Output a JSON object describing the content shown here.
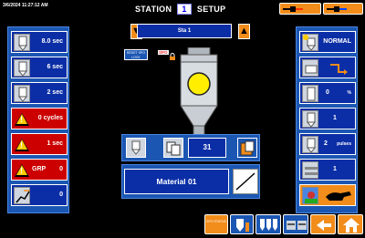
{
  "header": {
    "timestamp": "3/6/2024 11:27:12 AM",
    "title_left": "STATION",
    "station_number": "1",
    "title_right": "SETUP",
    "top_buttons": [
      {
        "label": "",
        "icon": "pump-icon",
        "accent": "#ff3300"
      },
      {
        "label": "",
        "icon": "pump-icon",
        "accent": "#0044ff"
      }
    ]
  },
  "station_selector": {
    "name": "Sta 1",
    "prev_icon": "arrow-down-icon",
    "next_icon": "arrow-up-icon"
  },
  "center": {
    "reset_label": "RESET SPO LOCK",
    "spo_label": "SPO",
    "lock_icon": "lock-icon",
    "count_value": "31",
    "material_name": "Material 01"
  },
  "left_panel": {
    "rows": [
      {
        "value": "8.0 sec",
        "icon": "valve-icon",
        "color": "blue"
      },
      {
        "value": "6 sec",
        "icon": "valve-icon",
        "color": "blue"
      },
      {
        "value": "2 sec",
        "icon": "valve-icon",
        "color": "blue"
      },
      {
        "value": "0 cycles",
        "icon": "warning-icon",
        "color": "red"
      },
      {
        "value": "1 sec",
        "icon": "warning-icon",
        "color": "red"
      },
      {
        "label": "GRP",
        "value": "0",
        "icon": "warning-icon",
        "color": "red"
      },
      {
        "value": "0",
        "icon": "chart-icon",
        "color": "blue"
      }
    ]
  },
  "right_panel": {
    "rows": [
      {
        "value": "NORMAL",
        "icon": "mode-icon"
      },
      {
        "value": "",
        "icon": "flow-icon"
      },
      {
        "value": "0",
        "unit": "%",
        "icon": "valve-icon"
      },
      {
        "value": "1",
        "icon": "valve-icon"
      },
      {
        "value": "2",
        "unit": "pulses",
        "icon": "valve-icon"
      },
      {
        "value": "1",
        "icon": "conveyor-icon"
      },
      {
        "value": "",
        "icon": "animal-icon"
      }
    ]
  },
  "bottom_bar": {
    "spo_status_label": "SPO STATUS",
    "buttons": [
      "spo-status",
      "station-config",
      "valves",
      "conveyors",
      "back",
      "home"
    ]
  },
  "colors": {
    "panel_bg": "#1b56b3",
    "field_bg": "#0b2ea6",
    "alarm_red": "#cc0000",
    "accent_orange": "#f28c1a"
  }
}
